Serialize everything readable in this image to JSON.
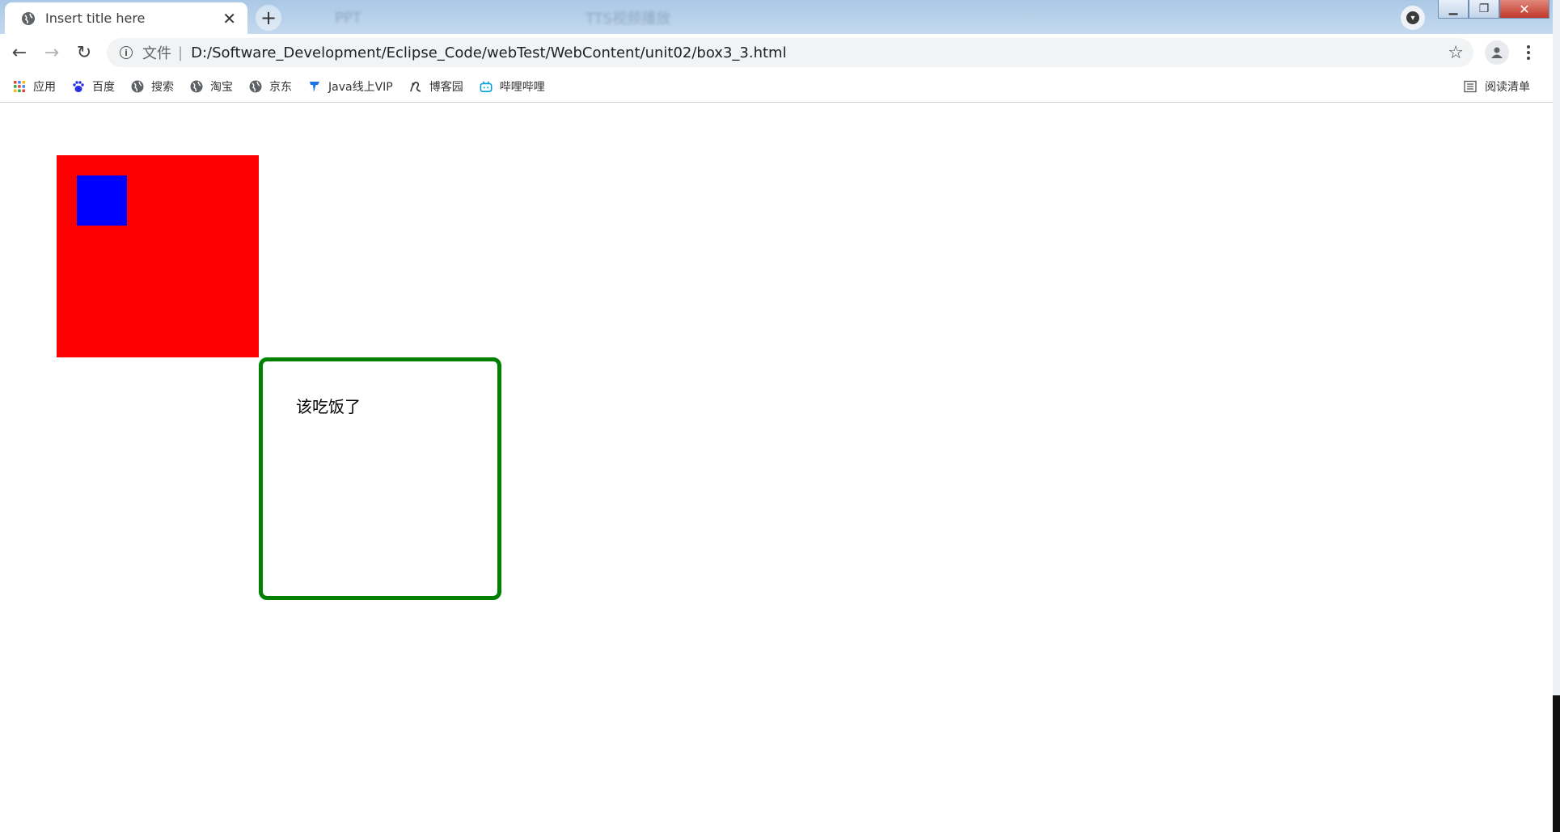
{
  "tabs": {
    "active_title": "Insert title here",
    "inactive": [
      "PPT",
      "TTS视频播放"
    ]
  },
  "toolbar": {
    "scheme_label": "文件",
    "url": "D:/Software_Development/Eclipse_Code/webTest/WebContent/unit02/box3_3.html"
  },
  "bookmarks": {
    "items": [
      {
        "label": "应用",
        "icon": "apps-grid-icon"
      },
      {
        "label": "百度",
        "icon": "baidu-paw-icon"
      },
      {
        "label": "搜索",
        "icon": "globe-icon"
      },
      {
        "label": "淘宝",
        "icon": "globe-icon"
      },
      {
        "label": "京东",
        "icon": "globe-icon"
      },
      {
        "label": "Java线上VIP",
        "icon": "t-logo-icon"
      },
      {
        "label": "博客园",
        "icon": "cnblogs-icon"
      },
      {
        "label": "哔哩哔哩",
        "icon": "bilibili-icon"
      }
    ],
    "reading_list": "阅读清单"
  },
  "page": {
    "green_box_text": "该吃饭了",
    "colors": {
      "outer": "#ff0000",
      "inner": "#0000ff",
      "border": "#008000"
    }
  }
}
